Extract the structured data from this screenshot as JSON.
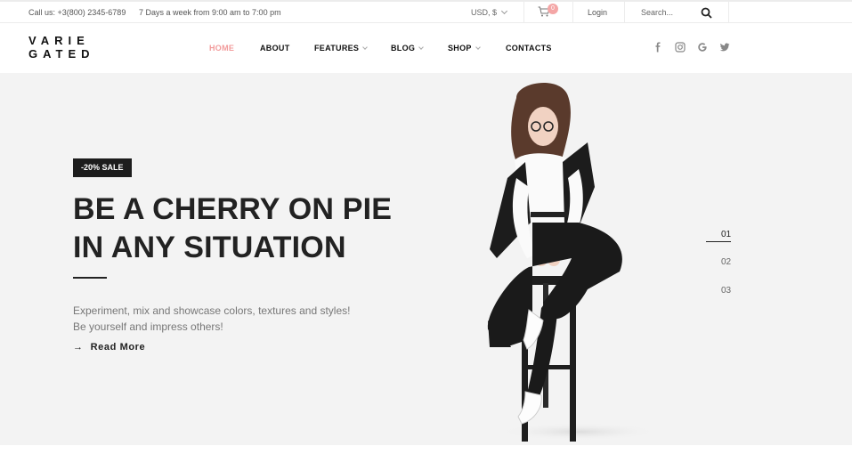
{
  "topbar": {
    "phone": "Call us: +3(800) 2345-6789",
    "hours": "7 Days a week from 9:00 am to 7:00 pm",
    "currency": "USD, $",
    "cart_count": "0",
    "login": "Login",
    "search_placeholder": "Search..."
  },
  "header": {
    "logo_line1": "VARIE",
    "logo_line2": "GATED",
    "nav": [
      {
        "label": "HOME"
      },
      {
        "label": "ABOUT"
      },
      {
        "label": "FEATURES"
      },
      {
        "label": "BLOG"
      },
      {
        "label": "SHOP"
      },
      {
        "label": "CONTACTS"
      }
    ],
    "social": [
      "facebook-icon",
      "instagram-icon",
      "google-icon",
      "twitter-icon"
    ]
  },
  "hero": {
    "badge": "-20% SALE",
    "title_line1": "BE A CHERRY ON PIE",
    "title_line2": "IN ANY SITUATION",
    "desc_line1": "Experiment, mix and showcase colors, textures and styles!",
    "desc_line2": "Be yourself and impress others!",
    "read_more": "Read More",
    "slides": [
      "01",
      "02",
      "03"
    ]
  },
  "colors": {
    "accent": "#f29b9b",
    "hero_bg": "#f3f3f3",
    "dark": "#1d1d1d"
  }
}
